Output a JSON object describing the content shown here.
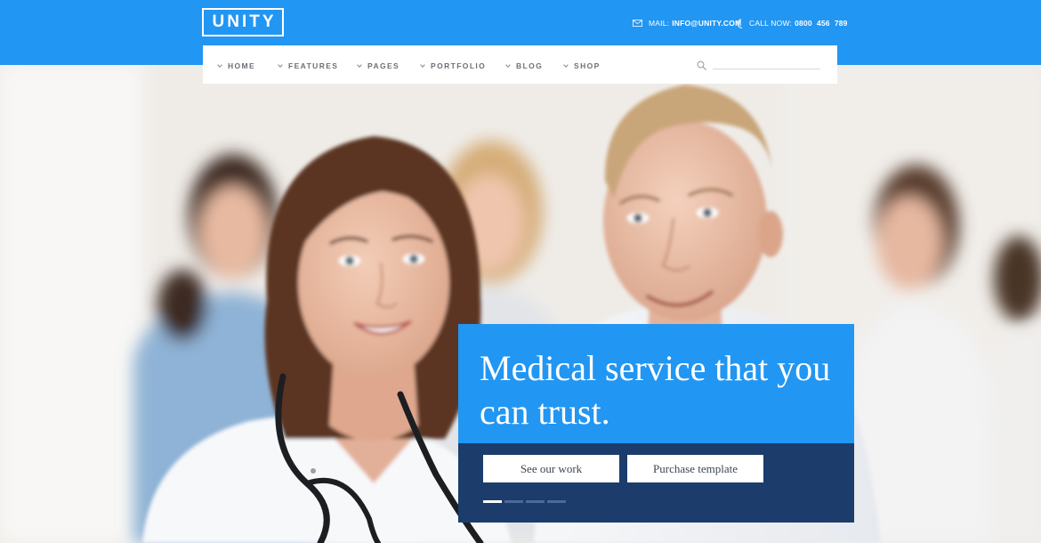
{
  "brand": {
    "logo_text": "UNITY"
  },
  "contact": {
    "mail_label": "MAIL:",
    "mail_value": "INFO@UNITY.COM",
    "phone_label": "CALL NOW:",
    "phone_value": "0800  456  789"
  },
  "nav": {
    "items": [
      {
        "label": "HOME"
      },
      {
        "label": "FEATURES"
      },
      {
        "label": "PAGES"
      },
      {
        "label": "PORTFOLIO"
      },
      {
        "label": "BLOG"
      },
      {
        "label": "SHOP"
      }
    ],
    "search_placeholder": ""
  },
  "hero": {
    "headline": "Medical service that you can trust.",
    "primary_button": "See our work",
    "secondary_button": "Purchase template",
    "slider": {
      "total_slides": 4,
      "active_slide": 1
    }
  },
  "colors": {
    "primary_blue": "#2196f3",
    "navy": "#1c3c6c",
    "nav_text": "#6b6f75"
  },
  "icons": {
    "mail": "mail-icon",
    "phone": "phone-icon",
    "search": "search-icon",
    "chevron": "chevron-down-icon"
  }
}
